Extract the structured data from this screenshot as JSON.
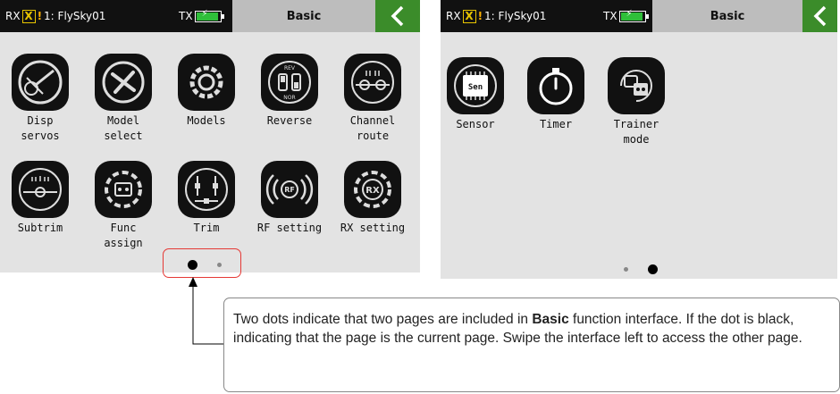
{
  "status_bar": {
    "rx_label": "RX",
    "rx_x": "X",
    "warning": "!",
    "model_name": "1: FlySky01",
    "tx_label": "TX",
    "battery_level_fraction": 0.85,
    "title": "Basic",
    "battery_color": "#2fbf3a",
    "back_button_color": "#3b8c2a"
  },
  "page1": {
    "apps": [
      {
        "label": "Disp\nservos",
        "icon": "servo-display-icon"
      },
      {
        "label": "Model\nselect",
        "icon": "airplane-select-icon"
      },
      {
        "label": "Models",
        "icon": "models-gear-icon"
      },
      {
        "label": "Reverse",
        "icon": "reverse-switch-icon",
        "icon_text_top": "REV",
        "icon_text_bottom": "NOR"
      },
      {
        "label": "Channel\nroute",
        "icon": "channel-route-icon"
      },
      {
        "label": "Subtrim",
        "icon": "subtrim-gauge-icon"
      },
      {
        "label": "Func\nassign",
        "icon": "func-assign-gear-icon"
      },
      {
        "label": "Trim",
        "icon": "trim-icon"
      },
      {
        "label": "RF setting",
        "icon": "rf-signal-icon",
        "icon_text": "RF"
      },
      {
        "label": "RX setting",
        "icon": "rx-gear-icon",
        "icon_text": "RX"
      }
    ],
    "current_page": 1,
    "page_count": 2
  },
  "page2": {
    "apps": [
      {
        "label": "Sensor",
        "icon": "sensor-chip-icon",
        "icon_text": "Sen"
      },
      {
        "label": "Timer",
        "icon": "timer-stopwatch-icon"
      },
      {
        "label": "Trainer\nmode",
        "icon": "trainer-mode-icon"
      }
    ],
    "current_page": 2,
    "page_count": 2
  },
  "callout": {
    "text_before": "Two dots indicate that two pages are included in ",
    "bold": "Basic",
    "text_after": " function interface. If the dot is black, indicating that the page is the current page. Swipe the interface left to access the other page."
  }
}
